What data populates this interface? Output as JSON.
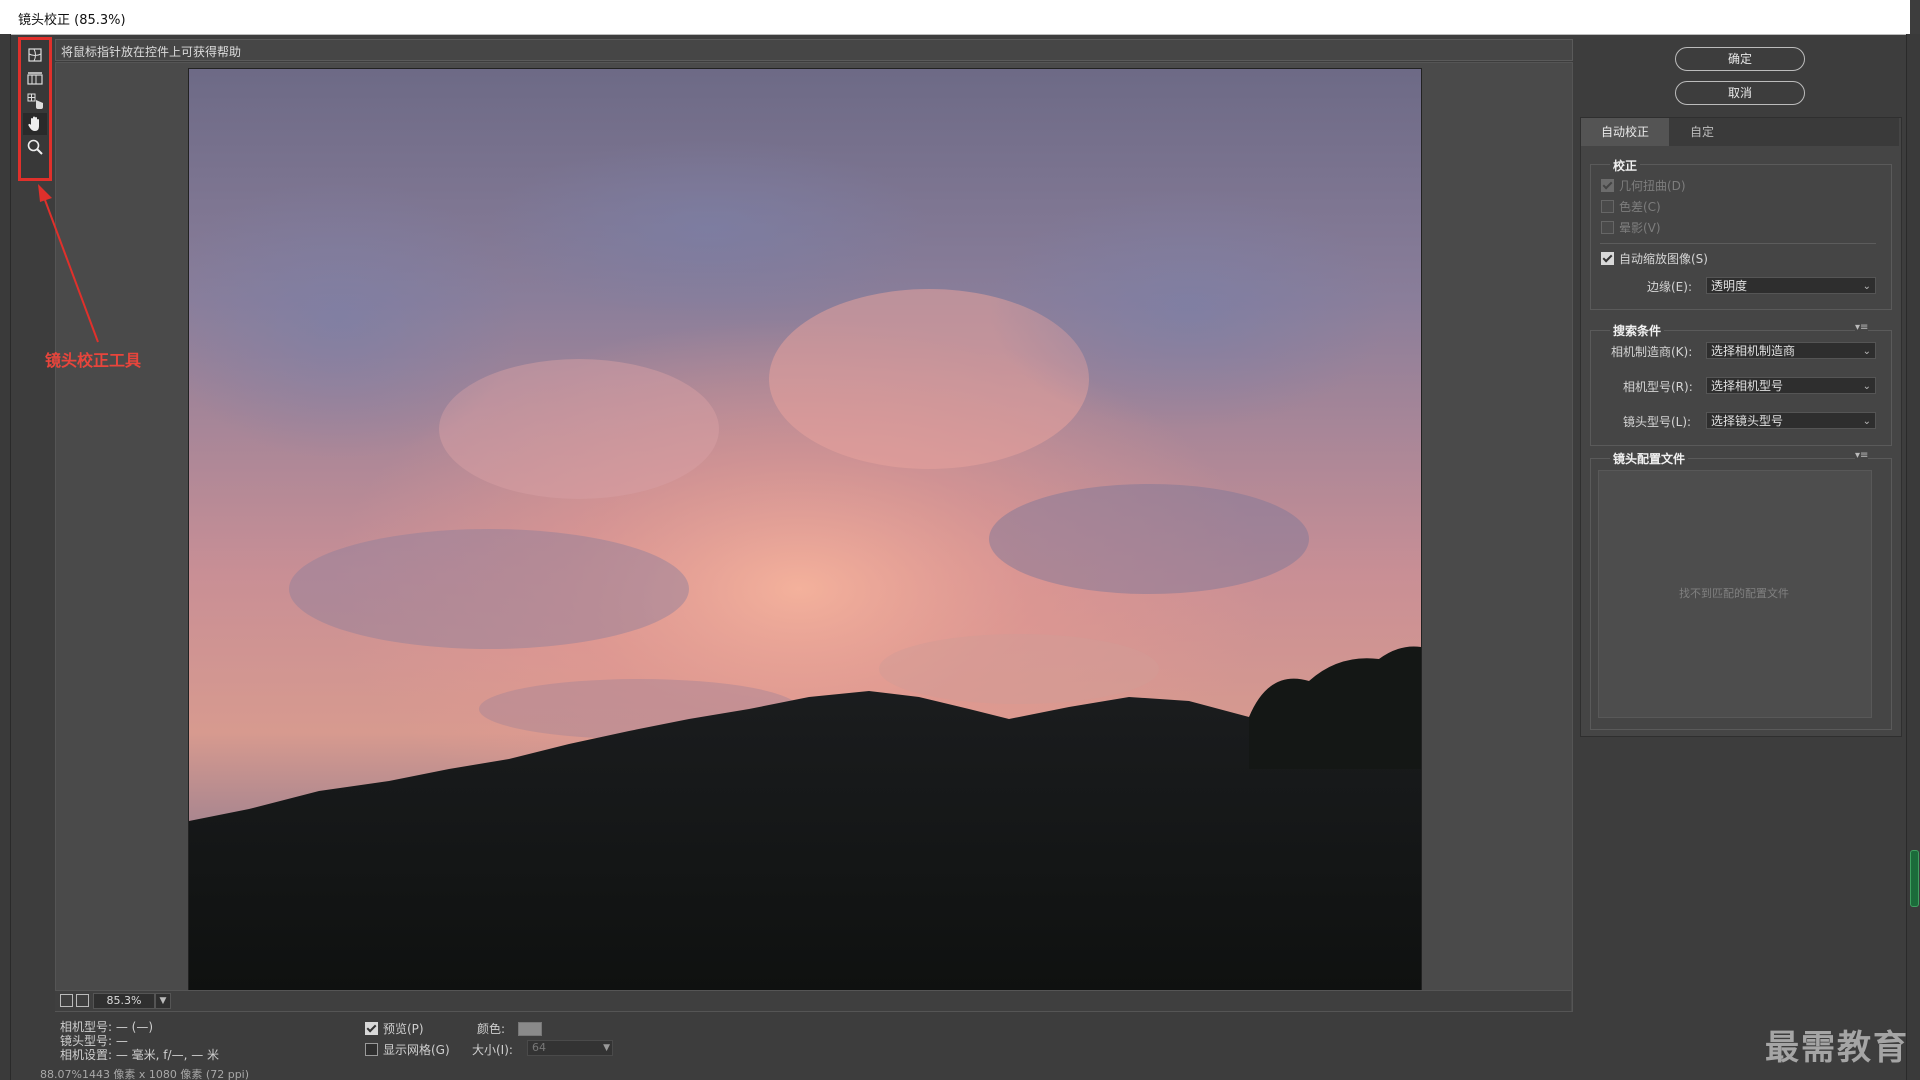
{
  "window": {
    "title": "镜头校正 (85.3%)"
  },
  "hint_bar": {
    "text": "将鼠标指针放在控件上可获得帮助"
  },
  "tools": [
    {
      "name": "remove-distortion-tool"
    },
    {
      "name": "straighten-tool"
    },
    {
      "name": "move-grid-tool"
    },
    {
      "name": "hand-tool"
    },
    {
      "name": "zoom-tool"
    }
  ],
  "annotation": {
    "label": "镜头校正工具",
    "color": "#e0302b"
  },
  "zoom": {
    "value": "85.3%"
  },
  "camera_info": {
    "camera_model": "相机型号: — (—)",
    "lens_model": "镜头型号: —",
    "camera_settings": "相机设置: — 毫米, f/—, — 米"
  },
  "preview_options": {
    "preview_label": "预览(P)",
    "preview_checked": true,
    "show_grid_label": "显示网格(G)",
    "show_grid_checked": false,
    "color_label": "颜色:",
    "size_label": "大小(I):",
    "size_value": "64"
  },
  "status": {
    "text": "88.07%1443 像素 x 1080 像素 (72 ppi)"
  },
  "buttons": {
    "ok": "确定",
    "cancel": "取消"
  },
  "tabs": [
    {
      "label": "自动校正",
      "active": true
    },
    {
      "label": "自定",
      "active": false
    }
  ],
  "correction": {
    "heading": "校正",
    "geometric": {
      "label": "几何扭曲(D)",
      "checked": true,
      "disabled": true
    },
    "chromatic": {
      "label": "色差(C)",
      "checked": false,
      "disabled": true
    },
    "vignette": {
      "label": "晕影(V)",
      "checked": false,
      "disabled": true
    },
    "auto_scale": {
      "label": "自动缩放图像(S)",
      "checked": true
    },
    "edge_label": "边缘(E):",
    "edge_value": "透明度"
  },
  "search": {
    "heading": "搜索条件",
    "maker_label": "相机制造商(K):",
    "maker_value": "选择相机制造商",
    "model_label": "相机型号(R):",
    "model_value": "选择相机型号",
    "lens_label": "镜头型号(L):",
    "lens_value": "选择镜头型号"
  },
  "profiles": {
    "heading": "镜头配置文件",
    "empty_text": "找不到匹配的配置文件"
  },
  "watermark": "最需教育",
  "colors": {
    "accent": "#e0302b",
    "background": "#3d3d3d",
    "panel": "#454545"
  }
}
